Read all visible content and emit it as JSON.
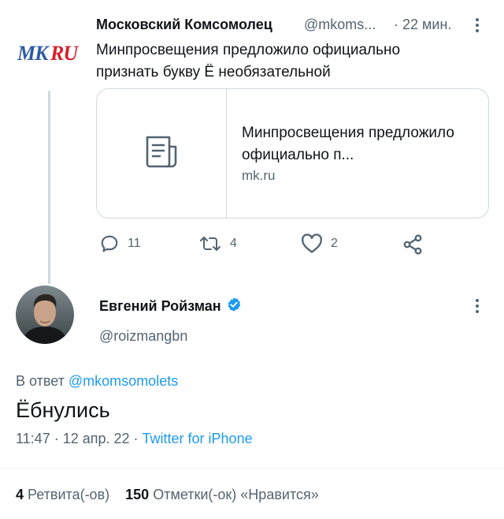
{
  "quoted_tweet": {
    "logo_text": "MKRU",
    "author_name": "Московский Комсомолец",
    "author_handle": "@mkoms...",
    "time": "· 22 мин.",
    "text": "Минпросвещения предложило официально признать букву Ё необязательной",
    "card": {
      "icon": "document-icon",
      "title": "Минпросвещения предложило официально п...",
      "domain": "mk.ru"
    },
    "actions": {
      "replies": "11",
      "retweets": "4",
      "likes": "2"
    }
  },
  "main_tweet": {
    "author_name": "Евгений Ройзман",
    "verified": true,
    "author_handle": "@roizmangbn",
    "reply_prefix": "В ответ",
    "reply_to": "@mkomsomolets",
    "text": "Ёбнулись",
    "timestamp": "11:47 · 12 апр. 22 ·",
    "source": "Twitter for iPhone",
    "stats": {
      "retweets_count": "4",
      "retweets_label": "Ретвита(-ов)",
      "likes_count": "150",
      "likes_label": "Отметки(-ок) «Нравится»"
    }
  },
  "colors": {
    "accent": "#1d9bf0",
    "secondary_text": "#536471",
    "primary_text": "#0f1419",
    "border": "#cfd9de",
    "logo_blue": "#2b59a5",
    "logo_red": "#d4202b"
  }
}
